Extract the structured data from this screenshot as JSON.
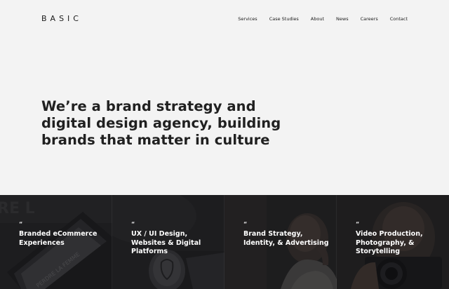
{
  "header": {
    "logo": "BASIC",
    "nav": [
      {
        "label": "Services"
      },
      {
        "label": "Case Studies"
      },
      {
        "label": "About"
      },
      {
        "label": "News"
      },
      {
        "label": "Careers"
      },
      {
        "label": "Contact"
      }
    ]
  },
  "hero": {
    "headline": "We’re a brand strategy and digital design agency, building brands that matter in culture"
  },
  "services": [
    {
      "quote_mark": "“",
      "title": "Branded eCommerce Experiences",
      "image": "tablet-product-photo"
    },
    {
      "quote_mark": "“",
      "title": "UX / UI Design, Websites & Digital Platforms",
      "image": "device-product-photo"
    },
    {
      "quote_mark": "“",
      "title": "Brand Strategy, Identity, & Advertising",
      "image": "portrait-photo"
    },
    {
      "quote_mark": "“",
      "title": "Video Production, Photography, & Storytelling",
      "image": "camera-photo"
    }
  ],
  "colors": {
    "background": "#f3f3f3",
    "text": "#1c1c1c",
    "tile_overlay": "#121214"
  }
}
